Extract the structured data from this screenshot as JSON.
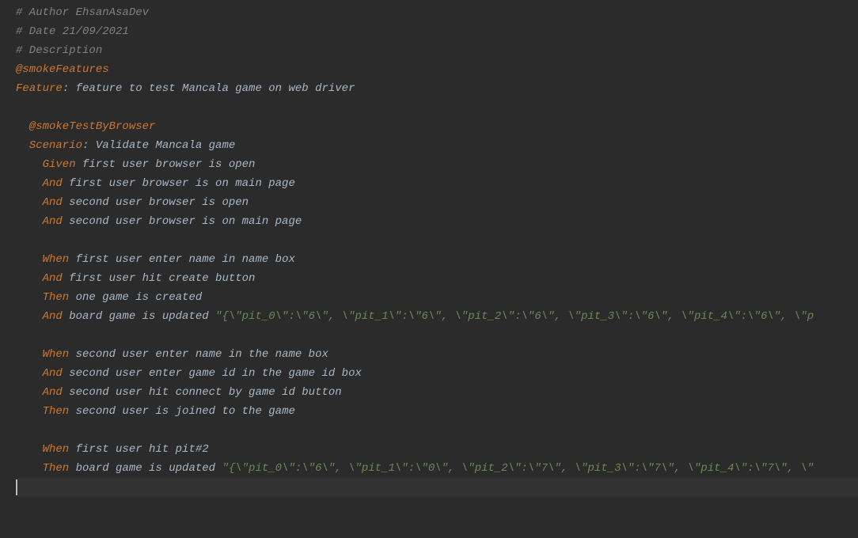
{
  "code": {
    "comment1": "# Author EhsanAsaDev",
    "comment2": "# Date 21/09/2021",
    "comment3": "# Description",
    "tag1": "@smokeFeatures",
    "featureKw": "Feature",
    "featureText": ": feature to test Mancala game on web driver",
    "tag2": "  @smokeTestByBrowser",
    "scenarioKw": "  Scenario",
    "scenarioText": ": Validate Mancala game",
    "givenKw": "    Given",
    "givenText": " first user browser is open",
    "and1Kw": "    And",
    "and1Text": " first user browser is on main page",
    "and2Kw": "    And",
    "and2Text": " second user browser is open",
    "and3Kw": "    And",
    "and3Text": " second user browser is on main page",
    "when1Kw": "    When",
    "when1Text": " first user enter name in name box",
    "and4Kw": "    And",
    "and4Text": " first user hit create button",
    "then1Kw": "    Then",
    "then1Text": " one game is created",
    "and5Kw": "    And",
    "and5Text": " board game is updated ",
    "string1": "\"{\\\"pit_0\\\":\\\"6\\\", \\\"pit_1\\\":\\\"6\\\", \\\"pit_2\\\":\\\"6\\\", \\\"pit_3\\\":\\\"6\\\", \\\"pit_4\\\":\\\"6\\\", \\\"p",
    "when2Kw": "    When",
    "when2Text": " second user enter name in the name box",
    "and6Kw": "    And",
    "and6Text": " second user enter game id in the game id box",
    "and7Kw": "    And",
    "and7Text": " second user hit connect by game id button",
    "then2Kw": "    Then",
    "then2Text": " second user is joined to the game",
    "when3Kw": "    When",
    "when3Text": " first user hit pit#2",
    "then3Kw": "    Then",
    "then3Text": " board game is updated ",
    "string2": "\"{\\\"pit_0\\\":\\\"6\\\", \\\"pit_1\\\":\\\"0\\\", \\\"pit_2\\\":\\\"7\\\", \\\"pit_3\\\":\\\"7\\\", \\\"pit_4\\\":\\\"7\\\", \\\""
  }
}
